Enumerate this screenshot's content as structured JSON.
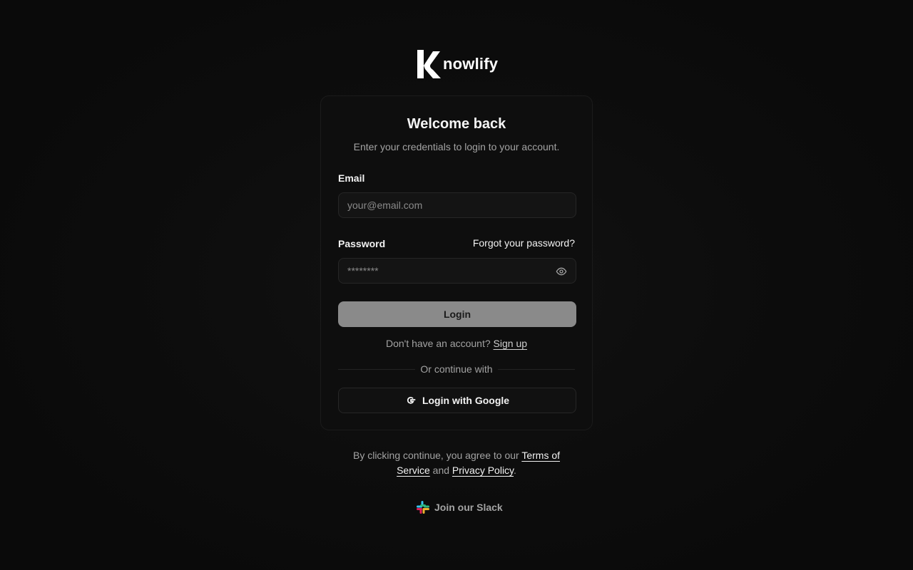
{
  "brand": {
    "name": "nowlify",
    "logo_icon": "knowlify-k-icon"
  },
  "card": {
    "title": "Welcome back",
    "subtitle": "Enter your credentials to login to your account.",
    "email": {
      "label": "Email",
      "placeholder": "your@email.com",
      "value": ""
    },
    "password": {
      "label": "Password",
      "placeholder": "********",
      "value": "",
      "forgot_link": "Forgot your password?",
      "toggle_icon": "eye-icon"
    },
    "login_button": "Login",
    "signup": {
      "prompt": "Don't have an account?",
      "link": "Sign up"
    },
    "divider_text": "Or continue with",
    "google_button": "Login with Google",
    "google_icon": "google-icon"
  },
  "legal": {
    "prefix": "By clicking continue, you agree to our",
    "terms": "Terms of Service",
    "and": "and",
    "privacy": "Privacy Policy",
    "suffix": "."
  },
  "slack": {
    "label": "Join our Slack",
    "icon": "slack-icon"
  },
  "colors": {
    "background": "#0b0b0b",
    "card_border": "#1b1b1b",
    "button_disabled": "#8a8a8a",
    "text_primary": "#f2f2f2",
    "text_muted": "#a3a3a3"
  }
}
